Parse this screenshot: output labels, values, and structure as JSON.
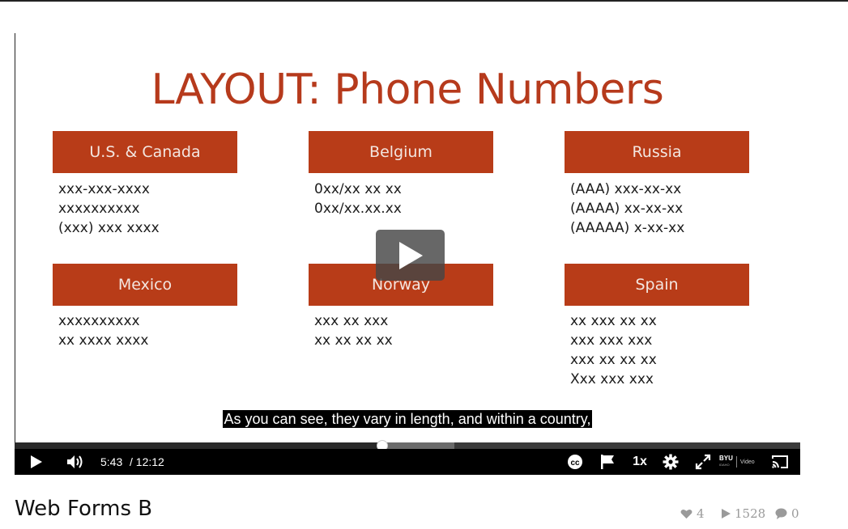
{
  "slide": {
    "title": "LAYOUT: Phone Numbers",
    "countries": [
      {
        "name": "U.S. & Canada",
        "formats": [
          "xxx-xxx-xxxx",
          "xxxxxxxxxx",
          "(xxx) xxx xxxx"
        ]
      },
      {
        "name": "Belgium",
        "formats": [
          "0xx/xx xx xx",
          "0xx/xx.xx.xx"
        ]
      },
      {
        "name": "Russia",
        "formats": [
          "(AAA) xxx-xx-xx",
          "(AAAA) xx-xx-xx",
          "(AAAAA) x-xx-xx"
        ]
      },
      {
        "name": "Mexico",
        "formats": [
          "xxxxxxxxxx",
          "xx xxxx xxxx"
        ]
      },
      {
        "name": "Norway",
        "formats": [
          "xxx xx xxx",
          "xx xx xx xx"
        ]
      },
      {
        "name": "Spain",
        "formats": [
          "xx xxx xx xx",
          "xxx xxx xxx",
          "xxx xx xx xx",
          "Xxx xxx xxx"
        ]
      }
    ]
  },
  "player": {
    "caption": "As you can see, they vary in length, and within a country,",
    "current_time": "5:43",
    "duration": "/ 12:12",
    "speed": "1x",
    "played_fraction": 0.468,
    "buffered_fraction": 0.56,
    "brand": "BYU",
    "brand_sub": "IDAHO",
    "brand_label": "Video",
    "colors": {
      "slide_accent": "#b83c18",
      "controls_bg": "#000000"
    },
    "icons": [
      "play-icon",
      "volume-icon",
      "closed-captions-icon",
      "flag-icon",
      "gear-icon",
      "fullscreen-icon",
      "cast-icon"
    ]
  },
  "video": {
    "title": "Web Forms B",
    "likes": "4",
    "plays": "1528",
    "comments": "0"
  }
}
